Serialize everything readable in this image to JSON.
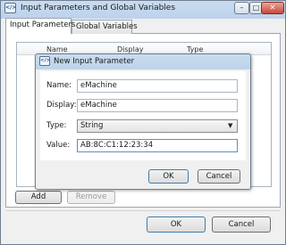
{
  "window": {
    "title": "Input Parameters and Global Variables",
    "icon_text": "</>",
    "controls": {
      "minimize": "–",
      "maximize": "□",
      "close": "✕"
    }
  },
  "tabs": [
    {
      "label": "Input Parameters",
      "selected": true
    },
    {
      "label": "Global Variables",
      "selected": false
    }
  ],
  "grid": {
    "columns": [
      "Name",
      "Display",
      "Type"
    ]
  },
  "actions": {
    "add_label": "Add",
    "remove_label": "Remove",
    "ok_label": "OK",
    "cancel_label": "Cancel"
  },
  "dialog": {
    "title": "New Input Parameter",
    "icon_text": "</>",
    "fields": {
      "name_label": "Name:",
      "name_value": "eMachine",
      "display_label": "Display:",
      "display_value": "eMachine",
      "type_label": "Type:",
      "type_value": "String",
      "value_label": "Value:",
      "value_value": "AB:8C:C1:12:23:34"
    },
    "ok_label": "OK",
    "cancel_label": "Cancel"
  },
  "colors": {
    "title_bar": "#c9dcf0",
    "close_button": "#c9463a",
    "focus_border": "#3c7fb1"
  }
}
